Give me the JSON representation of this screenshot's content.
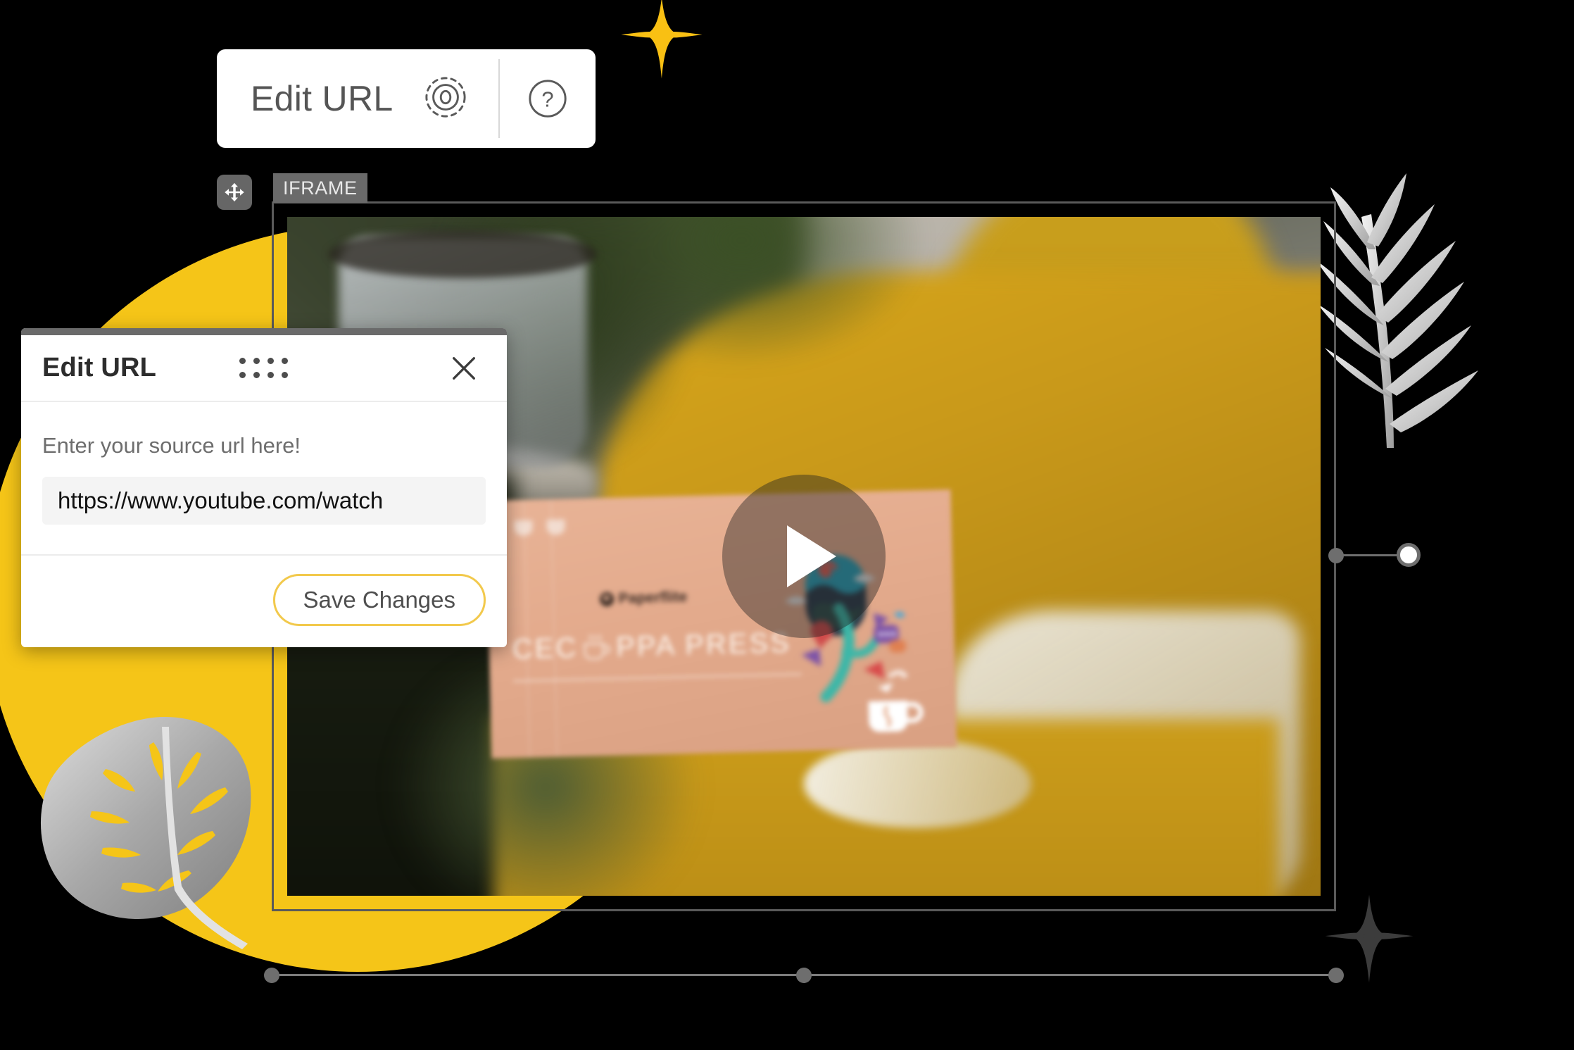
{
  "toolbar": {
    "label": "Edit URL",
    "target_icon": "target-focus-icon",
    "help_icon": "question-mark-icon"
  },
  "canvas": {
    "element_tag": "IFRAME",
    "move_handle_icon": "move-arrows-icon"
  },
  "dialog": {
    "title": "Edit URL",
    "drag_handle_icon": "drag-dots-icon",
    "close_icon": "close-x-icon",
    "field_label": "Enter your source url here!",
    "url_value": "https://www.youtube.com/watch",
    "url_placeholder": "Enter your source url here!",
    "save_label": "Save Changes"
  },
  "video": {
    "play_icon": "play-triangle-icon",
    "brand": "Paperflite",
    "box_title_left": "CEC",
    "box_title_right": "PPA PRESS",
    "cup_icon": "coffee-cup-icon"
  },
  "decor": {
    "sparkle_top_icon": "four-point-star-icon",
    "sparkle_bottom_icon": "four-point-star-icon",
    "palm_leaf_icon": "palm-leaf-icon",
    "monstera_leaf_icon": "monstera-leaf-icon",
    "circle_icon": "yellow-circle-shape"
  },
  "colors": {
    "accent_yellow": "#F5C518",
    "button_border": "#F2C94C",
    "selection_gray": "#6e6e6e",
    "dialog_bg": "#FFFFFF",
    "page_bg": "#000000"
  }
}
